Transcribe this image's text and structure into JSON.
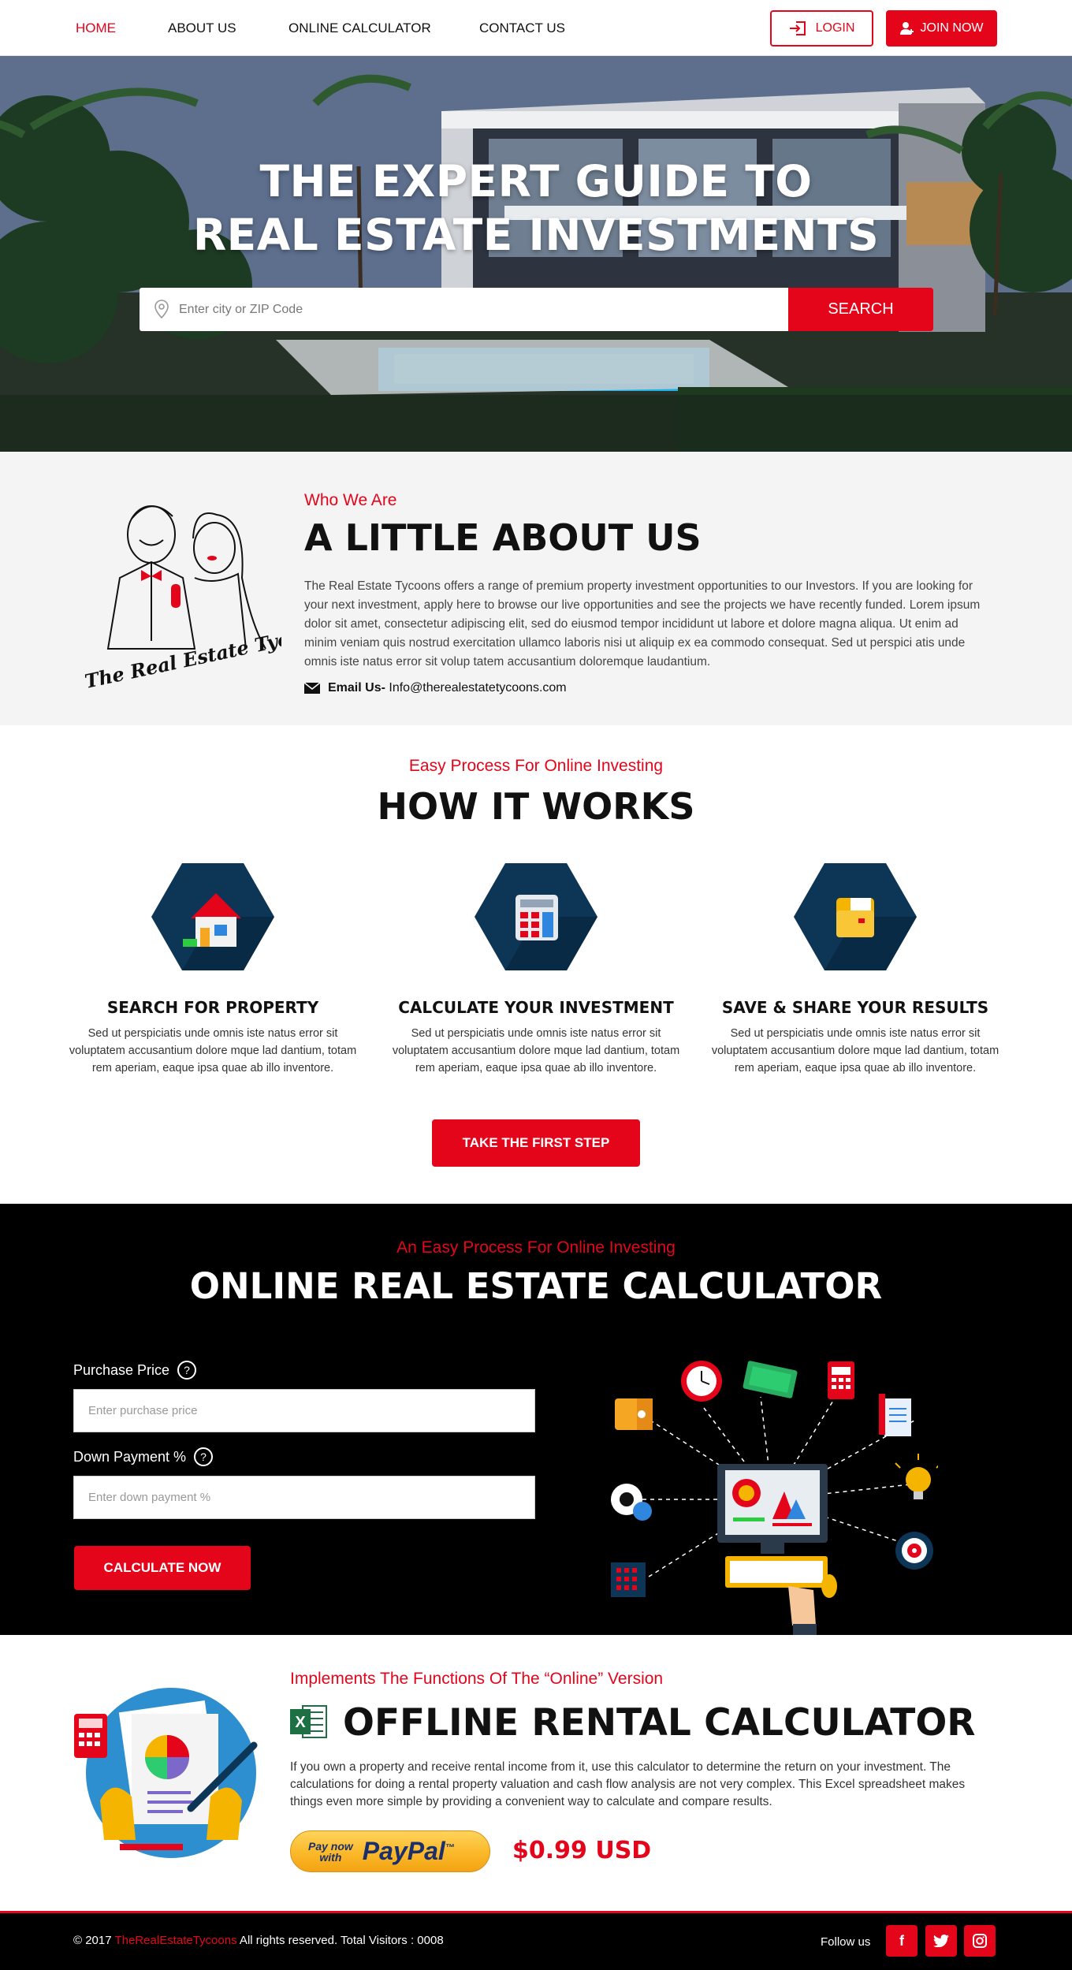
{
  "nav": {
    "links": [
      "HOME",
      "ABOUT US",
      "ONLINE CALCULATOR",
      "CONTACT US"
    ],
    "login": "LOGIN",
    "join": "JOIN NOW"
  },
  "hero": {
    "title_line1": "THE EXPERT GUIDE TO",
    "title_line2": "REAL ESTATE INVESTMENTS",
    "search_placeholder": "Enter city or ZIP Code",
    "search_button": "SEARCH"
  },
  "about": {
    "logo_text": "The Real Estate Tycoons",
    "subtitle": "Who We Are",
    "title": "A LITTLE ABOUT US",
    "body": "The Real Estate Tycoons offers a range of premium property investment opportunities to our Investors. If you are looking for your next investment, apply here to browse our live opportunities and see  the projects we have recently funded. Lorem ipsum dolor sit amet, consectetur adipiscing elit, sed do eiusmod tempor incididunt ut labore et dolore magna aliqua. Ut enim ad minim veniam quis nostrud exercitation ullamco laboris nisi ut aliquip ex ea commodo consequat. Sed ut perspici atis unde omnis iste natus error sit volup tatem accusantium doloremque laudantium.",
    "email_label": "Email Us-",
    "email": "Info@therealestatetycoons.com"
  },
  "how": {
    "subtitle": "Easy Process For Online Investing",
    "title": "HOW IT WORKS",
    "steps": [
      {
        "title": "SEARCH FOR PROPERTY",
        "text": "Sed ut perspiciatis unde omnis iste natus error sit voluptatem accusantium dolore mque lad dantium, totam rem aperiam, eaque ipsa quae ab illo inventore.",
        "icon": "house-icon"
      },
      {
        "title": "CALCULATE YOUR INVESTMENT",
        "text": "Sed ut perspiciatis unde omnis iste natus error sit voluptatem accusantium dolore mque lad dantium, totam rem aperiam, eaque ipsa quae ab illo inventore.",
        "icon": "calculator-icon"
      },
      {
        "title": "SAVE & SHARE YOUR RESULTS",
        "text": "Sed ut perspiciatis unde omnis iste natus error sit voluptatem accusantium dolore mque lad dantium, totam rem aperiam, eaque ipsa quae ab illo inventore.",
        "icon": "folder-icon"
      }
    ],
    "cta": "TAKE THE FIRST STEP"
  },
  "calculator": {
    "subtitle": "An Easy Process For Online Investing",
    "title": "ONLINE REAL ESTATE CALCULATOR",
    "purchase_label": "Purchase Price",
    "purchase_placeholder": "Enter purchase price",
    "down_label": "Down Payment %",
    "down_placeholder": "Enter down payment %",
    "help": "?",
    "button": "CALCULATE NOW"
  },
  "offline": {
    "subtitle": "Implements The Functions Of The “Online” Version",
    "title": "OFFLINE RENTAL CALCULATOR",
    "excel_letter": "X",
    "body": "If you own a property and receive rental income from it, use this calculator to determine the return on your investment. The calculations for doing a rental property valuation and cash flow analysis are not very complex. This Excel spreadsheet makes things even more simple by providing a convenient way to calculate and compare results.",
    "paypal_line1": "Pay now",
    "paypal_line2": "with",
    "paypal_brand": "PayPal",
    "paypal_tm": "™",
    "price": "$0.99 USD"
  },
  "footer": {
    "copy_prefix": "© 2017 ",
    "brand": "TheRealEstateTycoons",
    "copy_suffix": " All rights reserved. Total Visitors : 0008",
    "follow": "Follow us",
    "social": [
      "f",
      "t",
      "i"
    ]
  },
  "colors": {
    "accent": "#e4051b",
    "navy": "#0d3556",
    "dark": "#000000"
  }
}
